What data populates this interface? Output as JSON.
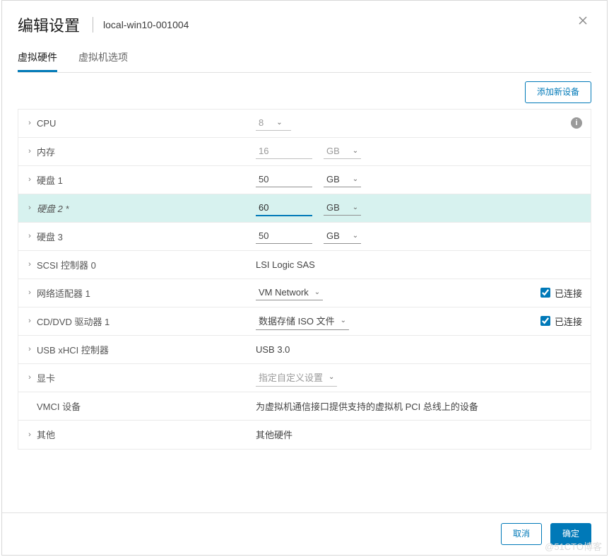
{
  "dialog": {
    "title": "编辑设置",
    "vm_name": "local-win10-001004"
  },
  "tabs": {
    "hardware": "虚拟硬件",
    "options": "虚拟机选项"
  },
  "actions": {
    "add_device": "添加新设备",
    "cancel": "取消",
    "ok": "确定"
  },
  "labels": {
    "connected": "已连接"
  },
  "rows": {
    "cpu": {
      "label": "CPU",
      "value": "8"
    },
    "mem": {
      "label": "内存",
      "value": "16",
      "unit": "GB"
    },
    "disk1": {
      "label": "硬盘 1",
      "value": "50",
      "unit": "GB"
    },
    "disk2": {
      "label": "硬盘 2 *",
      "value": "60",
      "unit": "GB"
    },
    "disk3": {
      "label": "硬盘 3",
      "value": "50",
      "unit": "GB"
    },
    "scsi": {
      "label": "SCSI 控制器 0",
      "value": "LSI Logic SAS"
    },
    "net1": {
      "label": "网络适配器 1",
      "value": "VM Network",
      "connected": true
    },
    "cddvd": {
      "label": "CD/DVD 驱动器 1",
      "value": "数据存储 ISO 文件",
      "connected": true
    },
    "usb": {
      "label": "USB xHCI 控制器",
      "value": "USB 3.0"
    },
    "gpu": {
      "label": "显卡",
      "value": "指定自定义设置"
    },
    "vmci": {
      "label": "VMCI 设备",
      "value": "为虚拟机通信接口提供支持的虚拟机 PCI 总线上的设备"
    },
    "other": {
      "label": "其他",
      "value": "其他硬件"
    }
  },
  "watermark": "@51CTO博客"
}
